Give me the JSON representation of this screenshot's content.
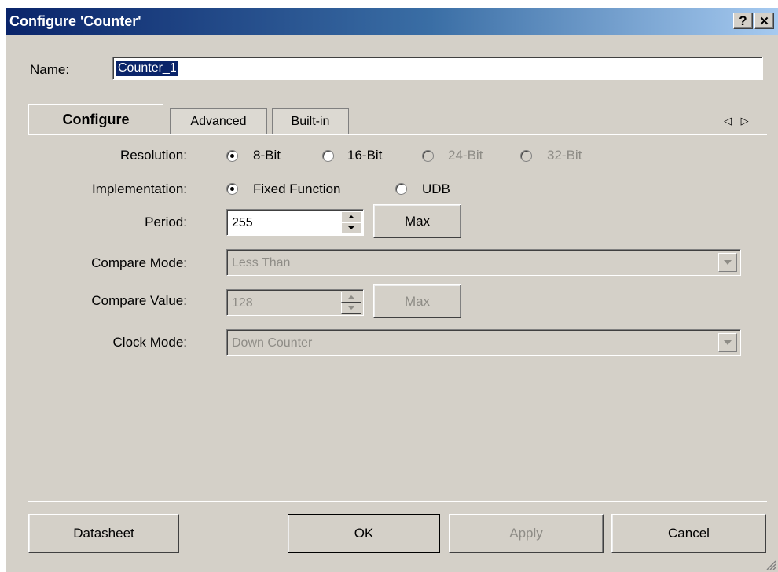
{
  "window": {
    "title": "Configure 'Counter'",
    "help_label": "?",
    "close_label": "✕"
  },
  "name": {
    "label": "Name:",
    "value": "Counter_1"
  },
  "tabs": [
    {
      "label": "Configure",
      "active": true
    },
    {
      "label": "Advanced",
      "active": false
    },
    {
      "label": "Built-in",
      "active": false
    }
  ],
  "tab_scroll": {
    "left": "◁",
    "right": "▷"
  },
  "resolution": {
    "label": "Resolution:",
    "options": [
      {
        "label": "8-Bit",
        "checked": true,
        "enabled": true
      },
      {
        "label": "16-Bit",
        "checked": false,
        "enabled": true
      },
      {
        "label": "24-Bit",
        "checked": false,
        "enabled": false
      },
      {
        "label": "32-Bit",
        "checked": false,
        "enabled": false
      }
    ]
  },
  "implementation": {
    "label": "Implementation:",
    "options": [
      {
        "label": "Fixed Function",
        "checked": true
      },
      {
        "label": "UDB",
        "checked": false
      }
    ]
  },
  "period": {
    "label": "Period:",
    "value": "255",
    "max_label": "Max"
  },
  "compare_mode": {
    "label": "Compare Mode:",
    "value": "Less Than"
  },
  "compare_value": {
    "label": "Compare Value:",
    "value": "128",
    "max_label": "Max"
  },
  "clock_mode": {
    "label": "Clock Mode:",
    "value": "Down Counter"
  },
  "buttons": {
    "datasheet": "Datasheet",
    "ok": "OK",
    "apply": "Apply",
    "cancel": "Cancel"
  },
  "colors": {
    "dialog_bg": "#d4d0c8",
    "title_start": "#0a246a",
    "title_end": "#a6caf0",
    "disabled_text": "#8e8c86"
  }
}
